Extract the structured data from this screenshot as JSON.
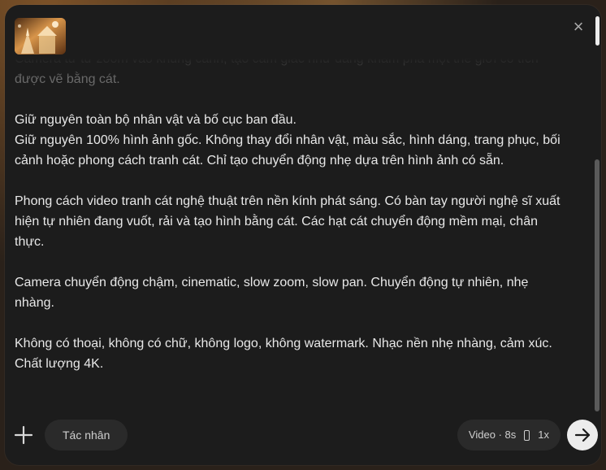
{
  "panel": {
    "thumbnail_alt": "sand-art-thumbnail",
    "close_label": "×"
  },
  "prompt": {
    "paragraphs": [
      "Camera từ từ zoom vào khung cảnh, tạo cảm giác như đang khám phá một thế giới cổ tích được vẽ bằng cát.",
      "Giữ nguyên toàn bộ nhân vật và bố cục ban đầu.\nGiữ nguyên 100% hình ảnh gốc. Không thay đổi nhân vật, màu sắc, hình dáng, trang phục, bối cảnh hoặc phong cách tranh cát. Chỉ tạo chuyển động nhẹ dựa trên hình ảnh có sẵn.",
      "Phong cách video tranh cát nghệ thuật trên nền kính phát sáng. Có bàn tay người nghệ sĩ xuất hiện tự nhiên đang vuốt, rải và tạo hình bằng cát. Các hạt cát chuyển động mềm mại, chân thực.",
      "Camera chuyển động chậm, cinematic, slow zoom, slow pan. Chuyển động tự nhiên, nhẹ nhàng.",
      "Không có thoại, không có chữ, không logo, không watermark. Nhạc nền nhẹ nhàng, cảm xúc. Chất lượng 4K."
    ]
  },
  "bottom_bar": {
    "agent_label": "Tác nhân",
    "settings": {
      "type_label": "Video",
      "separator": "·",
      "duration_label": "8s",
      "count_label": "1x"
    }
  },
  "icons": {
    "add": "plus-icon",
    "send": "arrow-right-icon",
    "aspect": "portrait-aspect-icon",
    "close": "close-icon"
  },
  "colors": {
    "panel_bg": "#1c1c1c",
    "text": "#e8e8e8",
    "faded_text": "#6a6a6a",
    "chip_bg": "#2a2a2a",
    "send_bg": "#ececec"
  }
}
